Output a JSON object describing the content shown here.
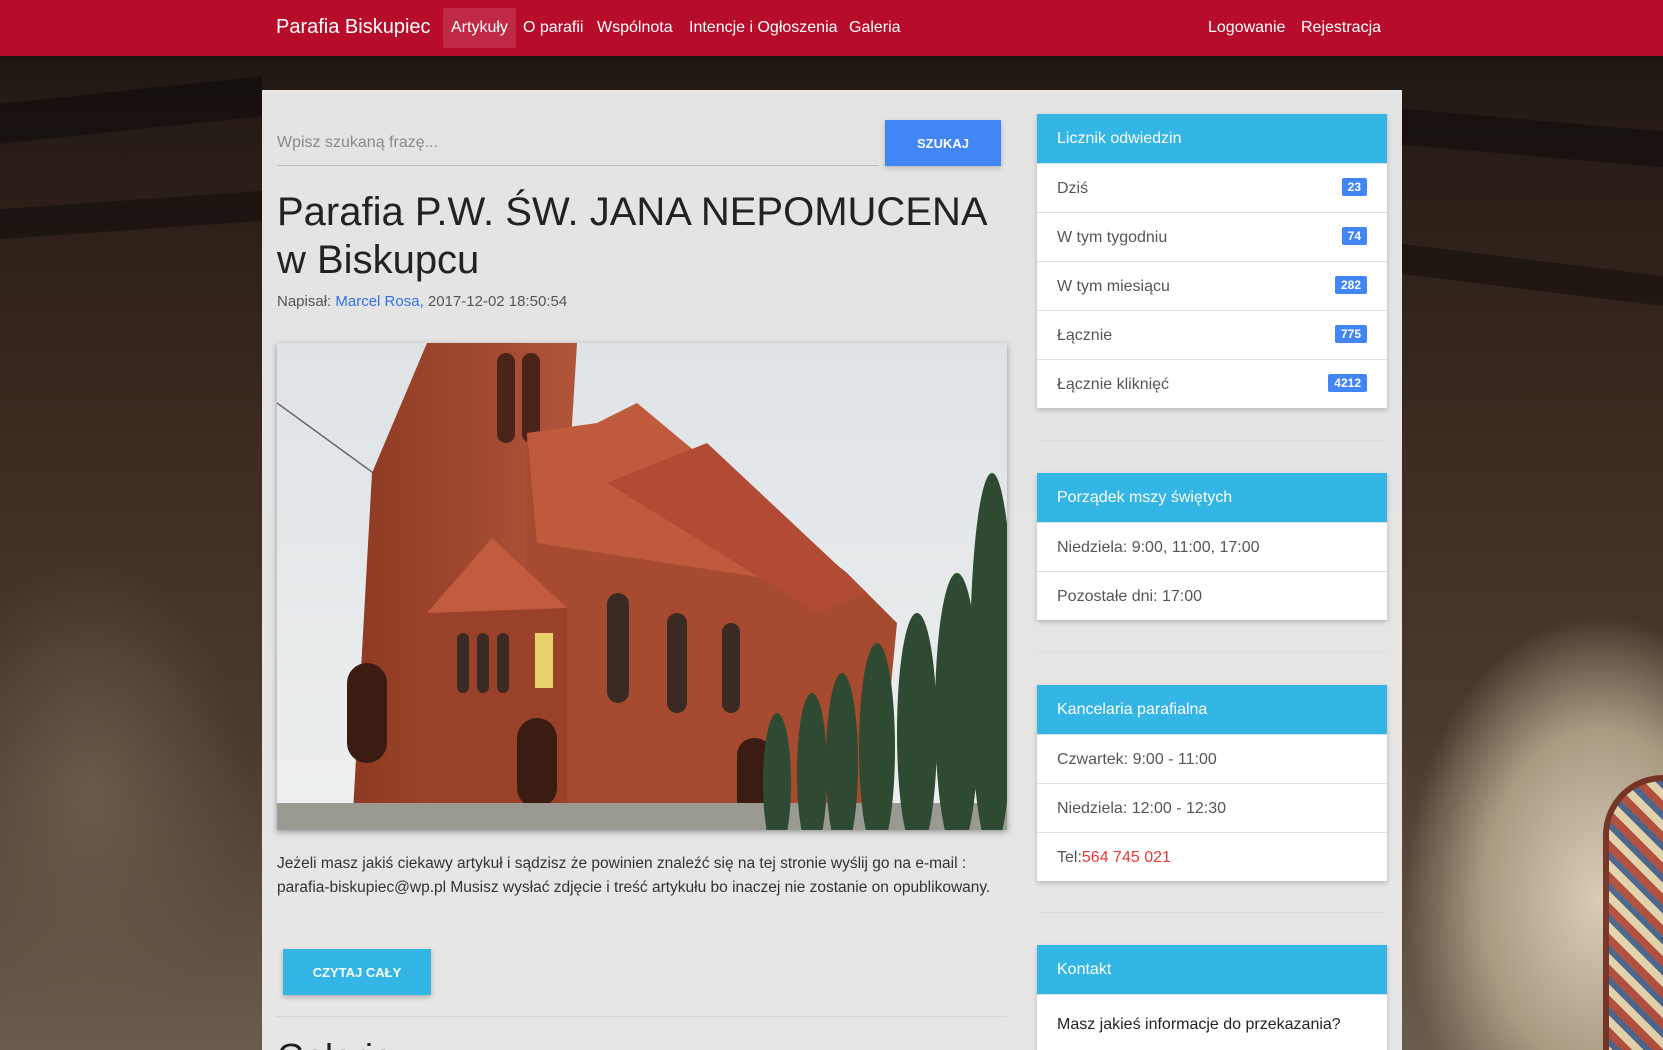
{
  "nav": {
    "brand": "Parafia Biskupiec",
    "items": [
      {
        "label": "Artykuły"
      },
      {
        "label": "O parafii"
      },
      {
        "label": "Wspólnota"
      },
      {
        "label": "Intencje i Ogłoszenia"
      },
      {
        "label": "Galeria"
      }
    ],
    "active_index": 0,
    "login": "Logowanie",
    "register": "Rejestracja"
  },
  "search": {
    "placeholder": "Wpisz szukaną frazę...",
    "button": "SZUKAJ"
  },
  "article": {
    "title": "Parafia P.W. ŚW. JANA NEPOMUCENA w Biskupcu",
    "meta_prefix": "Napisał:",
    "author": "Marcel Rosa,",
    "date": "2017-12-02 18:50:54",
    "excerpt": "Jeżeli masz jakiś ciekawy artykuł i sądzisz że powinien znaleźć się na tej stronie wyślij go na e-mail : parafia-biskupiec@wp.pl    Musisz wysłać zdjęcie i treść artykułu bo inaczej nie zostanie on opublikowany.",
    "read_more": "CZYTAJ CAŁY"
  },
  "next_section_title": "Galeria",
  "visits": {
    "title": "Licznik odwiedzin",
    "rows": [
      {
        "label": "Dziś",
        "value": "23"
      },
      {
        "label": "W tym tygodniu",
        "value": "74"
      },
      {
        "label": "W tym miesiącu",
        "value": "282"
      },
      {
        "label": "Łącznie",
        "value": "775"
      },
      {
        "label": "Łącznie kliknięć",
        "value": "4212"
      }
    ]
  },
  "mass": {
    "title": "Porządek mszy świętych",
    "rows": [
      "Niedziela: 9:00, 11:00, 17:00",
      "Pozostałe dni: 17:00"
    ]
  },
  "office": {
    "title": "Kancelaria parafialna",
    "rows": [
      "Czwartek: 9:00 - 11:00",
      "Niedziela: 12:00 - 12:30"
    ],
    "tel_label": "Tel:",
    "tel": "564 745 021"
  },
  "contact": {
    "title": "Kontakt",
    "prompt": "Masz jakieś informacje do przekazania?"
  },
  "colors": {
    "navbar": "#b80c2b",
    "widget_header": "#33b5e5",
    "primary_button": "#4285f4",
    "badge": "#4285f4",
    "link": "#3273dc",
    "phone": "#e53935"
  }
}
